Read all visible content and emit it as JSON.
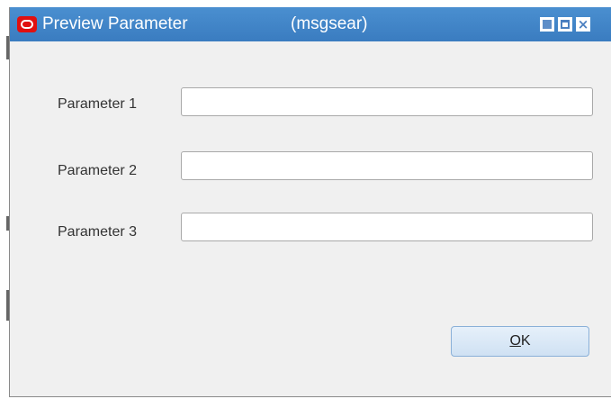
{
  "window": {
    "title": "Preview Parameter",
    "subtitle": "(msgsear)",
    "controls": {
      "minimize_icon": "minimize-icon",
      "maximize_icon": "maximize-icon",
      "close_icon": "close-icon",
      "close_glyph": "×"
    },
    "app_icon": "oracle-logo-icon",
    "accent_color": "#3a7cc0"
  },
  "form": {
    "fields": [
      {
        "label": "Parameter 1",
        "value": "",
        "placeholder": ""
      },
      {
        "label": "Parameter 2",
        "value": "",
        "placeholder": ""
      },
      {
        "label": "Parameter 3",
        "value": "",
        "placeholder": ""
      }
    ],
    "ok_button": {
      "mnemonic": "O",
      "rest": "K"
    }
  }
}
